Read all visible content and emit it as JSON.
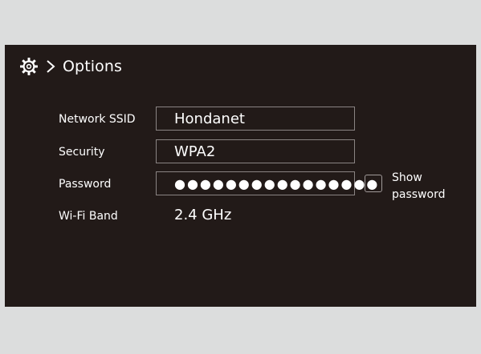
{
  "header": {
    "title": "Options",
    "settings_icon": "gear-icon",
    "separator_icon": "chevron-right-icon"
  },
  "form": {
    "ssid": {
      "label": "Network SSID",
      "value": "Hondanet"
    },
    "security": {
      "label": "Security",
      "value": "WPA2"
    },
    "password": {
      "label": "Password",
      "value": "●●●●●●●●●●●●●●●●",
      "show_label": "Show password",
      "show_checked": false
    },
    "band": {
      "label": "Wi-Fi Band",
      "value": "2.4 GHz"
    }
  },
  "colors": {
    "background": "#dcdddd",
    "screen": "#221a18",
    "text": "#ffffff",
    "field_border": "#8a8483"
  }
}
